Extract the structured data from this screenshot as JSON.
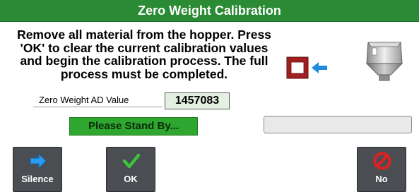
{
  "window": {
    "title": "Zero Weight Calibration"
  },
  "instructions": "Remove all material from the hopper.  Press 'OK' to clear the current calibration values and begin the calibration process.  The full process must be completed.",
  "ad_field": {
    "label": "Zero Weight AD Value",
    "value": "1457083"
  },
  "status": {
    "text": "Please Stand By..."
  },
  "progress": {
    "percent": 0
  },
  "buttons": {
    "silence": "Silence",
    "ok": "OK",
    "no": "No"
  },
  "icons": {
    "silence": "arrow-right-icon",
    "ok": "checkmark-icon",
    "no": "prohibited-icon",
    "device": "load-cell-arrow-icon",
    "hopper": "hopper-icon"
  },
  "colors": {
    "title_bar": "#2b8a34",
    "status_bg": "#2fa62f",
    "value_bg": "#e4f0e2",
    "button_bg": "#4a4d51"
  }
}
